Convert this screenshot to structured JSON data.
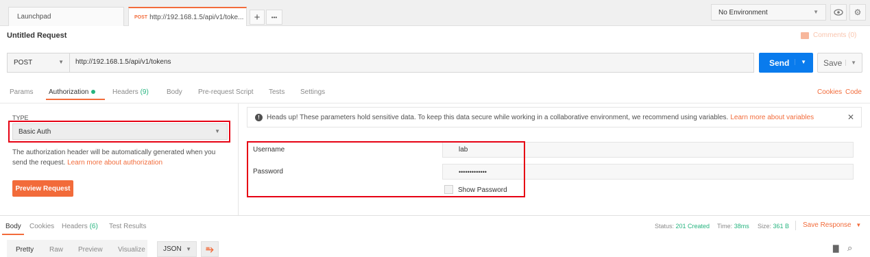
{
  "tabs": {
    "launchpad": "Launchpad",
    "request_method": "POST",
    "request_title": "http://192.168.1.5/api/v1/toke...",
    "new_tab": "+",
    "more": "•••"
  },
  "environment": {
    "selected": "No Environment"
  },
  "request": {
    "name": "Untitled Request",
    "comments": "Comments (0)",
    "method": "POST",
    "url": "http://192.168.1.5/api/v1/tokens",
    "send": "Send",
    "save": "Save"
  },
  "request_tabs": {
    "params": "Params",
    "authorization": "Authorization",
    "headers": "Headers",
    "headers_count": "(9)",
    "body": "Body",
    "pre_request": "Pre-request Script",
    "tests": "Tests",
    "settings": "Settings",
    "cookies": "Cookies",
    "code": "Code"
  },
  "auth": {
    "type_label": "TYPE",
    "type_value": "Basic Auth",
    "description": "The authorization header will be automatically generated when you send the request.",
    "learn_more": "Learn more about authorization",
    "preview_button": "Preview Request",
    "notice": "Heads up! These parameters hold sensitive data. To keep this data secure while working in a collaborative environment, we recommend using variables.",
    "notice_link": "Learn more about variables",
    "username_label": "Username",
    "username_value": "lab",
    "password_label": "Password",
    "password_value": "•••••••••••••",
    "show_password": "Show Password"
  },
  "response_tabs": {
    "body": "Body",
    "cookies": "Cookies",
    "headers": "Headers",
    "headers_count": "(6)",
    "test_results": "Test Results"
  },
  "response_status": {
    "status_label": "Status:",
    "status_value": "201 Created",
    "time_label": "Time:",
    "time_value": "38ms",
    "size_label": "Size:",
    "size_value": "361 B",
    "save_response": "Save Response"
  },
  "body_formats": {
    "pretty": "Pretty",
    "raw": "Raw",
    "preview": "Preview",
    "visualize": "Visualize",
    "language": "JSON"
  },
  "colors": {
    "accent": "#f26b3a",
    "send_blue": "#097bed",
    "success_green": "#26b47f",
    "highlight_red": "#e60012"
  }
}
